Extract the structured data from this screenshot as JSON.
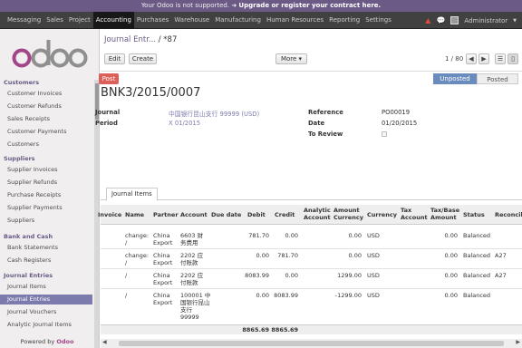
{
  "notice": {
    "prefix": "Your Odoo is not supported.",
    "link": "Upgrade or register your contract here."
  },
  "topmenu": [
    "Messaging",
    "Sales",
    "Project",
    "Accounting",
    "Purchases",
    "Warehouse",
    "Manufacturing",
    "Human Resources",
    "Reporting",
    "Settings"
  ],
  "topmenu_active": "Accounting",
  "user": "Administrator",
  "sidebar": {
    "sections": [
      {
        "title": "Customers",
        "items": [
          "Customer Invoices",
          "Customer Refunds",
          "Sales Receipts",
          "Customer Payments",
          "Customers"
        ]
      },
      {
        "title": "Suppliers",
        "items": [
          "Supplier Invoices",
          "Supplier Refunds",
          "Purchase Receipts",
          "Supplier Payments",
          "Suppliers"
        ]
      },
      {
        "title": "Bank and Cash",
        "items": [
          "Bank Statements",
          "Cash Registers"
        ]
      },
      {
        "title": "Journal Entries",
        "items": [
          "Journal Items",
          "Journal Entries",
          "Journal Vouchers",
          "Analytic Journal Items"
        ]
      }
    ],
    "active_item": "Journal Entries",
    "powered_prefix": "Powered by",
    "powered_brand": "Odoo"
  },
  "breadcrumb": {
    "parent": "Journal Entr...",
    "current": "/ *87"
  },
  "buttons": {
    "edit": "Edit",
    "create": "Create",
    "more": "More ▾",
    "post": "Post"
  },
  "pager": "1 / 80",
  "status": {
    "current": "Unposted",
    "other": "Posted"
  },
  "record": {
    "title": "BNK3/2015/0007",
    "journal_label": "Journal",
    "journal_value": "中国银行昆山支行 99999 (USD)",
    "period_label": "Period",
    "period_value": "X 01/2015",
    "reference_label": "Reference",
    "reference_value": "PO00019",
    "date_label": "Date",
    "date_value": "01/20/2015",
    "toreview_label": "To Review"
  },
  "tab": "Journal Items",
  "table": {
    "headers": [
      "Invoice",
      "Name",
      "Partner",
      "Account",
      "Due date",
      "Debit",
      "Credit",
      "Analytic Account",
      "Amount Currency",
      "Currency",
      "Tax Account",
      "Tax/Base Amount",
      "Status",
      "Reconcile"
    ],
    "rows": [
      {
        "name": "change: /",
        "partner": "China Export",
        "account": "6603 财务费用",
        "debit": "781.70",
        "credit": "0.00",
        "amount_currency": "0.00",
        "currency": "USD",
        "tax_base": "0.00",
        "status": "Balanced",
        "reconcile": ""
      },
      {
        "name": "change: /",
        "partner": "China Export",
        "account": "2202 应付账款",
        "debit": "0.00",
        "credit": "781.70",
        "amount_currency": "0.00",
        "currency": "USD",
        "tax_base": "0.00",
        "status": "Balanced",
        "reconcile": "A27"
      },
      {
        "name": "/",
        "partner": "China Export",
        "account": "2202 应付账款",
        "debit": "8083.99",
        "credit": "0.00",
        "amount_currency": "1299.00",
        "currency": "USD",
        "tax_base": "0.00",
        "status": "Balanced",
        "reconcile": "A27"
      },
      {
        "name": "/",
        "partner": "China Export",
        "account": "100001 中国银行昆山支行 99999",
        "debit": "0.00",
        "credit": "8083.99",
        "amount_currency": "-1299.00",
        "currency": "USD",
        "tax_base": "0.00",
        "status": "Balanced",
        "reconcile": ""
      }
    ],
    "total_debit": "8865.69",
    "total_credit": "8865.69"
  },
  "colors": {
    "brand": "#7c7bad",
    "topbar": "#414141",
    "notice": "#6c5a86",
    "post": "#dc5f59"
  }
}
